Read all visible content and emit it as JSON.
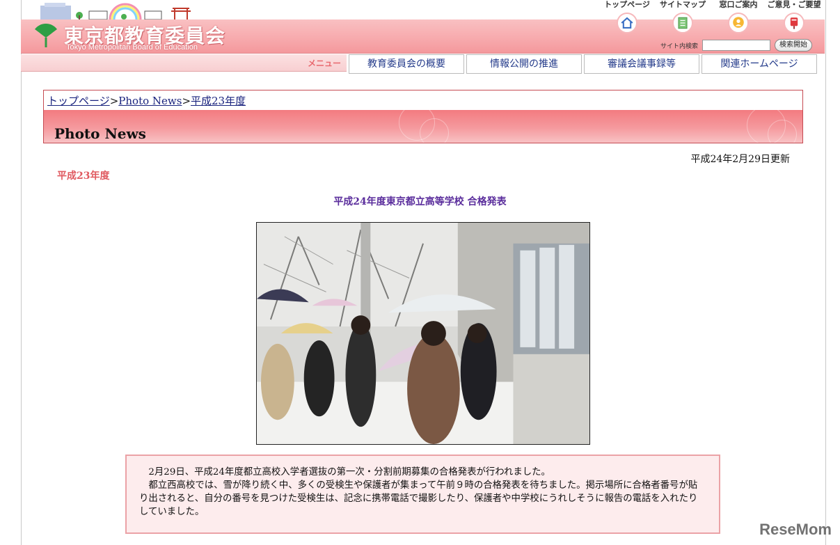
{
  "header": {
    "logo_ja": "東京都教育委員会",
    "logo_en": "Tokyo Metropolitan Board of Education",
    "top_links": [
      {
        "label": "トップページ",
        "icon": "home-icon"
      },
      {
        "label": "サイトマップ",
        "icon": "sitemap-icon"
      },
      {
        "label": "窓口ご案内",
        "icon": "info-desk-icon"
      },
      {
        "label": "ご意見・ご要望",
        "icon": "mailbox-icon"
      }
    ],
    "search_label": "サイト内検索",
    "search_value": "",
    "search_button": "検索開始"
  },
  "nav": {
    "menu_label": "メニュー",
    "tabs": [
      "教育委員会の概要",
      "情報公開の推進",
      "審議会議事録等",
      "関連ホームページ"
    ]
  },
  "breadcrumb": {
    "items": [
      "トップページ",
      "Photo News",
      "平成23年度"
    ],
    "separator": ">"
  },
  "page_title": "Photo News",
  "updated": "平成24年2月29日更新",
  "year_heading": "平成23年度",
  "article": {
    "title": "平成24年度東京都立高等学校 合格発表",
    "paragraphs": [
      "2月29日、平成24年度都立高校入学者選抜の第一次・分割前期募集の合格発表が行われました。",
      "都立西高校では、雪が降り続く中、多くの受検生や保護者が集まって午前９時の合格発表を待ちました。掲示場所に合格者番号が貼り出されると、自分の番号を見つけた受検生は、記念に携帯電話で撮影したり、保護者や中学校にうれしそうに報告の電話を入れたりしていました。"
    ]
  },
  "watermark": "ReseMom",
  "colors": {
    "banner_pink": "#f7a9ac",
    "title_red": "#f37b80",
    "link_blue": "#1a237e",
    "year_red": "#e05a60",
    "article_title_purple": "#5a2d9c",
    "textbox_bg": "#fdeced"
  }
}
